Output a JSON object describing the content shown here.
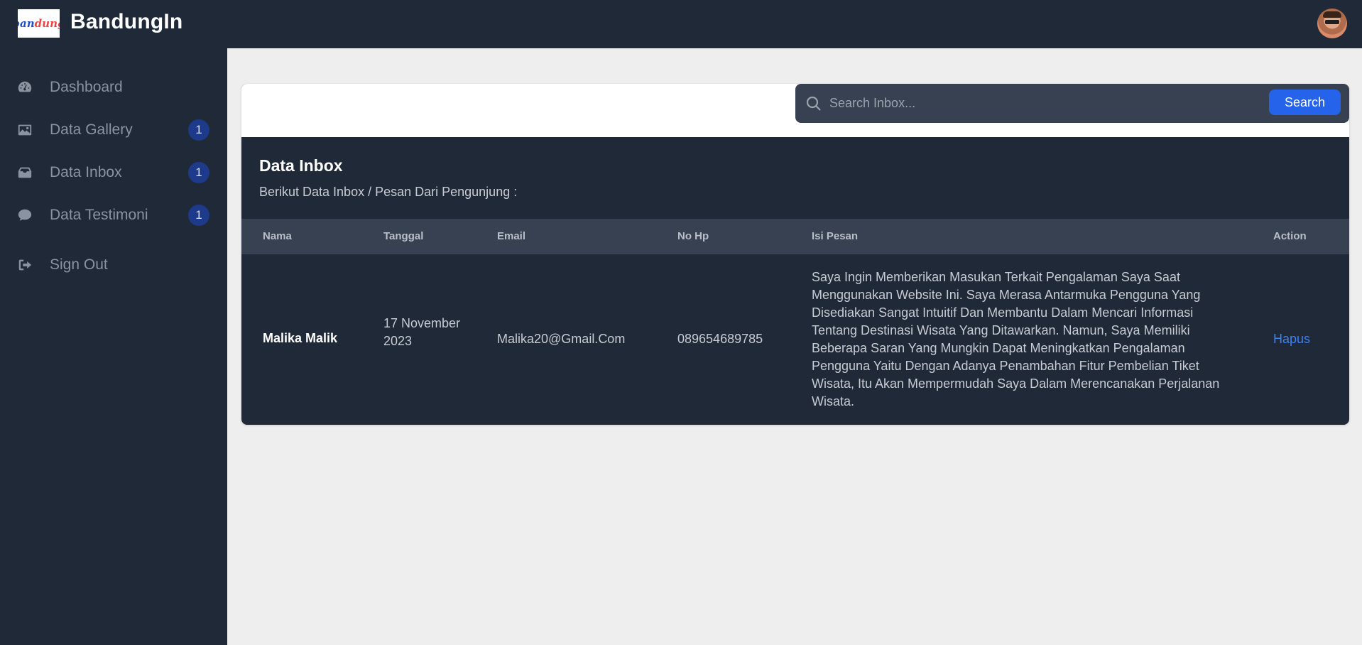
{
  "app": {
    "logo_text_a": "ban",
    "logo_text_b": "dung",
    "brand": "BandungIn"
  },
  "sidebar": {
    "items": [
      {
        "label": "Dashboard",
        "icon": "dashboard-gauge-icon",
        "badge": ""
      },
      {
        "label": "Data Gallery",
        "icon": "image-icon",
        "badge": "1"
      },
      {
        "label": "Data Inbox",
        "icon": "inbox-icon",
        "badge": "1"
      },
      {
        "label": "Data Testimoni",
        "icon": "comment-icon",
        "badge": "1"
      },
      {
        "label": "Sign Out",
        "icon": "sign-out-icon",
        "badge": ""
      }
    ]
  },
  "search": {
    "placeholder": "Search Inbox...",
    "button_label": "Search"
  },
  "panel": {
    "title": "Data Inbox",
    "subtitle": "Berikut Data Inbox / Pesan Dari Pengunjung :"
  },
  "table": {
    "columns": [
      "Nama",
      "Tanggal",
      "Email",
      "No Hp",
      "Isi Pesan",
      "Action"
    ],
    "rows": [
      {
        "nama": "Malika Malik",
        "tanggal": "17 November 2023",
        "email": "Malika20@Gmail.Com",
        "no_hp": "089654689785",
        "isi_pesan": "Saya Ingin Memberikan Masukan Terkait Pengalaman Saya Saat Menggunakan Website Ini. Saya Merasa Antarmuka Pengguna Yang Disediakan Sangat Intuitif Dan Membantu Dalam Mencari Informasi Tentang Destinasi Wisata Yang Ditawarkan. Namun, Saya Memiliki Beberapa Saran Yang Mungkin Dapat Meningkatkan Pengalaman Pengguna Yaitu Dengan Adanya Penambahan Fitur Pembelian Tiket Wisata, Itu Akan Mempermudah Saya Dalam Merencanakan Perjalanan Wisata.",
        "action": "Hapus"
      }
    ]
  },
  "colors": {
    "topbar": "#1f2937",
    "sidebar": "#1f2937",
    "accent": "#2563eb",
    "badge": "#1e3a8a",
    "link": "#3b82f6"
  }
}
